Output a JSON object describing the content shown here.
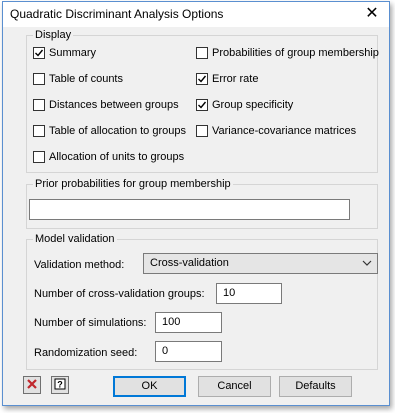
{
  "window": {
    "title": "Quadratic Discriminant Analysis Options"
  },
  "display": {
    "legend": "Display",
    "options": [
      {
        "label": "Summary",
        "checked": true
      },
      {
        "label": "Table of counts",
        "checked": false
      },
      {
        "label": "Distances between groups",
        "checked": false
      },
      {
        "label": "Table of allocation to groups",
        "checked": false
      },
      {
        "label": "Allocation of units to groups",
        "checked": false
      },
      {
        "label": "Probabilities of group membership",
        "checked": false
      },
      {
        "label": "Error rate",
        "checked": true
      },
      {
        "label": "Group specificity",
        "checked": true
      },
      {
        "label": "Variance-covariance matrices",
        "checked": false
      }
    ]
  },
  "prior": {
    "legend": "Prior probabilities for group membership",
    "value": ""
  },
  "validation": {
    "legend": "Model validation",
    "method_label": "Validation method:",
    "method_value": "Cross-validation",
    "groups_label": "Number of cross-validation groups:",
    "groups_value": "10",
    "sims_label": "Number of simulations:",
    "sims_value": "100",
    "seed_label": "Randomization seed:",
    "seed_value": "0"
  },
  "buttons": {
    "ok": "OK",
    "cancel": "Cancel",
    "defaults": "Defaults"
  },
  "icons": {
    "close": "close-icon",
    "clear": "clear-red-x-icon",
    "help": "help-question-icon"
  },
  "colors": {
    "check": "#000000",
    "red_x": "#c0282d",
    "focus_border": "#0078d7"
  }
}
